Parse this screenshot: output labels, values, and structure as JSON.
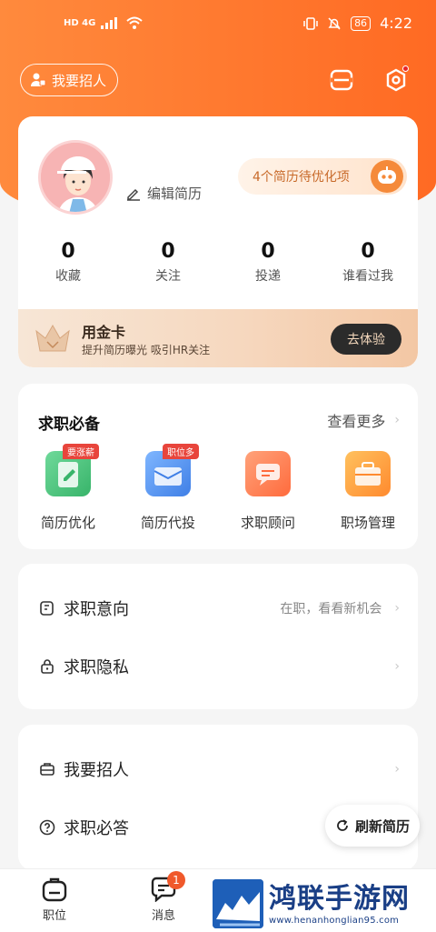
{
  "status_bar": {
    "network": "HD 4G",
    "time": "4:22",
    "battery": "86"
  },
  "header": {
    "recruit_label": "我要招人"
  },
  "profile": {
    "edit_label": "编辑简历",
    "optimize_label": "4个简历待优化项",
    "stats": [
      {
        "value": "0",
        "label": "收藏"
      },
      {
        "value": "0",
        "label": "关注"
      },
      {
        "value": "0",
        "label": "投递"
      },
      {
        "value": "0",
        "label": "谁看过我"
      }
    ],
    "gold_card": {
      "title": "用金卡",
      "subtitle": "提升简历曝光 吸引HR关注",
      "button": "去体验"
    }
  },
  "job_essentials": {
    "title": "求职必备",
    "more": "查看更多",
    "tools": [
      {
        "label": "简历优化",
        "badge": "要涨薪",
        "color": "#4cc07a",
        "icon": "resume-edit-icon"
      },
      {
        "label": "简历代投",
        "badge": "职位多",
        "color": "#3f8ff0",
        "icon": "resume-delivery-icon"
      },
      {
        "label": "求职顾问",
        "badge": "",
        "color": "#ff7a45",
        "icon": "consultant-chat-icon"
      },
      {
        "label": "职场管理",
        "badge": "",
        "color": "#ff9a2e",
        "icon": "briefcase-icon"
      }
    ]
  },
  "list1": [
    {
      "title": "求职意向",
      "right": "在职，看看新机会",
      "icon": "intention-icon"
    },
    {
      "title": "求职隐私",
      "right": "",
      "icon": "lock-icon"
    }
  ],
  "list2": [
    {
      "title": "我要招人",
      "right": "",
      "icon": "recruit-case-icon"
    },
    {
      "title": "求职必答",
      "right": "",
      "icon": "question-icon"
    }
  ],
  "refresh_label": "刷新简历",
  "tabs": [
    {
      "label": "职位",
      "badge": ""
    },
    {
      "label": "消息",
      "badge": "1"
    }
  ],
  "watermark": {
    "title": "鸿联手游网",
    "url": "www.henanhonglian95.com"
  },
  "colors": {
    "brand": "#ff6a23",
    "badge_red": "#e8453c"
  }
}
